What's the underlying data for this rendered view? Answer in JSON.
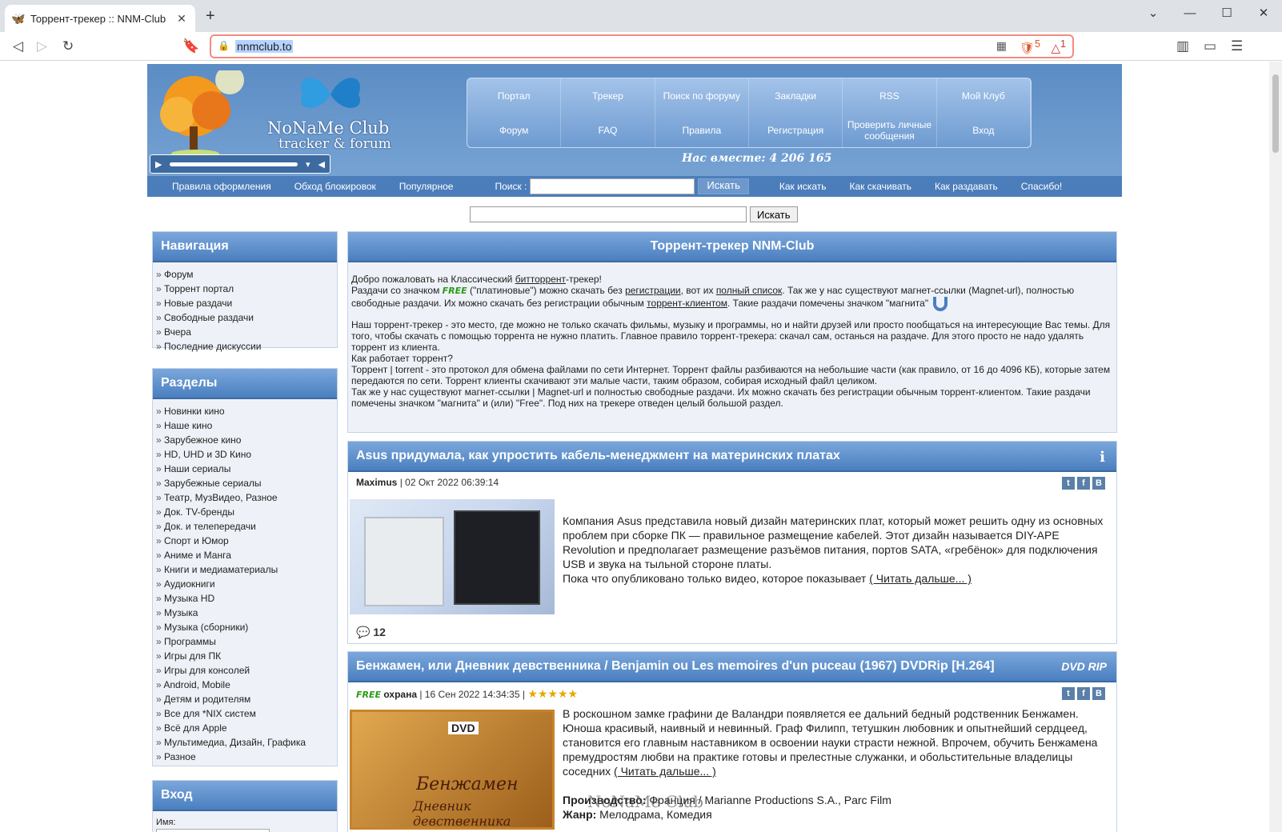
{
  "browser": {
    "tab_title": "Торрент-трекер :: NNM-Club",
    "url": "nnmclub.to",
    "new_tab_symbol": "+",
    "shield_badge": "5",
    "rewards_badge": "1"
  },
  "header": {
    "logo_line1": "NoNaMe Club",
    "logo_line2": "tracker & forum",
    "menu": [
      {
        "label": "Портал"
      },
      {
        "label": "Трекер"
      },
      {
        "label": "Поиск по форуму"
      },
      {
        "label": "Закладки"
      },
      {
        "label": "RSS"
      },
      {
        "label": "Мой Клуб"
      },
      {
        "label": "Форум"
      },
      {
        "label": "FAQ"
      },
      {
        "label": "Правила"
      },
      {
        "label": "Регистрация"
      },
      {
        "label": "Проверить личные сообщения"
      },
      {
        "label": "Вход"
      }
    ],
    "together": "Нас вместе: 4 206 165"
  },
  "subnav": {
    "links": [
      "Правила оформления",
      "Обход блокировок",
      "Популярное"
    ],
    "search_label": "Поиск :",
    "search_button": "Искать",
    "right_links": [
      "Как искать",
      "Как скачивать",
      "Как раздавать",
      "Спасибо!"
    ]
  },
  "topsearch": {
    "button": "Искать"
  },
  "sidebar": {
    "nav_title": "Навигация",
    "nav_items": [
      "Форум",
      "Торрент портал",
      "Новые раздачи",
      "Свободные раздачи",
      "Вчера",
      "Последние дискуссии"
    ],
    "sections_title": "Разделы",
    "section_items": [
      "Новинки кино",
      "Наше кино",
      "Зарубежное кино",
      "HD, UHD и 3D Кино",
      "Наши сериалы",
      "Зарубежные сериалы",
      "Театр, МузВидео, Разное",
      "Док. TV-бренды",
      "Док. и телепередачи",
      "Спорт и Юмор",
      "Аниме и Манга",
      "Книги и медиаматериалы",
      "Аудиокниги",
      "Музыка HD",
      "Музыка",
      "Музыка (сборники)",
      "Программы",
      "Игры для ПК",
      "Игры для консолей",
      "Android, Mobile",
      "Детям и родителям",
      "Все для *NIX систем",
      "Всё для Apple",
      "Мультимедиа, Дизайн, Графика",
      "Разное"
    ],
    "login_title": "Вход",
    "login_name_label": "Имя:"
  },
  "welcome": {
    "title": "Торрент-трекер NNM-Club",
    "p1_a": "Добро пожаловать на Классический ",
    "p1_link": "битторрент",
    "p1_b": "-трекер!",
    "p2_a": "Раздачи со значком ",
    "free_label": "FREE",
    "p2_b": " (\"платиновые\") можно скачать без ",
    "p2_link1": "регистрации",
    "p2_c": ", вот их ",
    "p2_link2": "полный список",
    "p2_d": ". Так же у нас существуют магнет-ссылки (Magnet-url), полностью свободные раздачи. Их можно скачать без регистрации обычным ",
    "p2_link3": "торрент-клиентом",
    "p2_e": ". Такие раздачи помечены значком \"магнита\"",
    "p3": "Наш торрент-трекер - это место, где можно не только скачать фильмы, музыку и программы, но и найти друзей или просто пообщаться на интересующие Вас темы. Для того, чтобы скачать с помощью торрента не нужно платить. Главное правило торрент-трекера: скачал сам, останься на раздаче. Для этого просто не надо удалять торрент из клиента.",
    "p4": "Как работает торрент?",
    "p5": "Торрент | torrent - это протокол для обмена файлами по сети Интернет. Торрент файлы разбиваются на небольшие части (как правило, от 16 до 4096 КБ), которые затем передаются по сети. Торрент клиенты скачивают эти малые части, таким образом, собирая исходный файл целиком.",
    "p6": "Так же у нас существуют магнет-ссылки | Magnet-url и полностью свободные раздачи. Их можно скачать без регистрации обычным торрент-клиентом. Такие раздачи помечены значком \"магнита\" и (или) \"Free\". Под них на трекере отведен целый большой раздел."
  },
  "news1": {
    "title": "Asus придумала, как упростить кабель-менеджмент на материнских платах",
    "author": "Maximus",
    "date": "| 02 Окт 2022 06:39:14",
    "text": "Компания Asus представила новый дизайн материнских плат, который может решить одну из основных проблем при сборке ПК — правильное размещение кабелей. Этот дизайн называется DIY-APE Revolution и предполагает размещение разъёмов питания, портов SATA, «гребёнок» для подключения USB и звука на тыльной стороне платы.",
    "text2": "Пока что опубликовано только видео, которое показывает",
    "more": "( Читать дальше... )",
    "comments": "12",
    "info_icon": "i"
  },
  "news2": {
    "title": "Бенжамен, или Дневник девственника / Benjamin ou Les memoires d'un puceau (1967) DVDRip [H.264]",
    "badge": "DVD RIP",
    "free_label": "FREE",
    "author": "охрана",
    "date": "| 16 Сен 2022 14:34:35 |",
    "stars": "★★★★★",
    "text": "В роскошном замке графини де Валандри появляется ее дальний бедный родственник Бенжамен. Юноша красивый, наивный и невинный. Граф Филипп, тетушкин любовник и опытнейший сердцеед, становится его главным наставником в освоении науки страсти нежной. Впрочем, обучить Бенжамена премудростям любви на практике готовы и прелестные служанки, и обольстительные владелицы соседних",
    "more": "( Читать дальше... )",
    "prod_label": "Производство:",
    "prod": "Франция / Marianne Productions S.A., Parc Film",
    "genre_label": "Жанр:",
    "genre": "Мелодрама, Комедия",
    "poster_label": "DVD",
    "poster_title": "Бенжамен",
    "poster_sub": "Дневник девственника"
  },
  "watermark": "NoNaMe Club",
  "colors": {
    "accent": "#4a7fc0",
    "header": "#5b8cc4",
    "free": "#2a9a15"
  }
}
